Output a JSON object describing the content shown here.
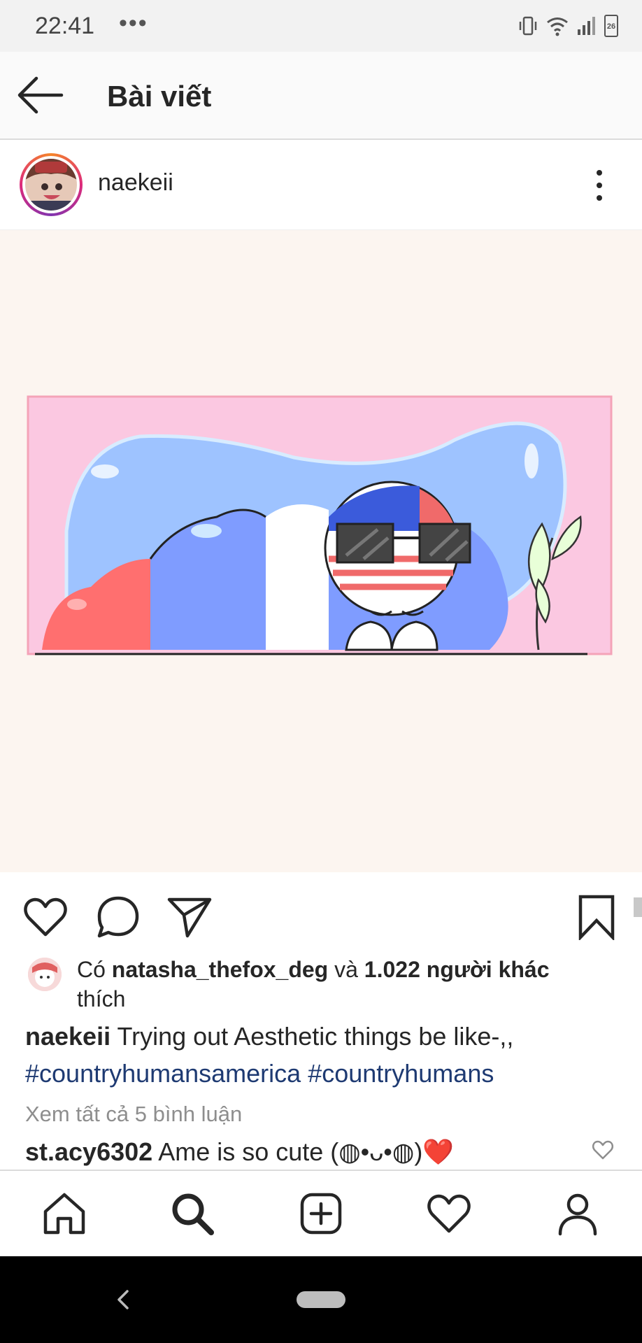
{
  "status_bar": {
    "time": "22:41",
    "more": "•••",
    "battery": "26"
  },
  "header": {
    "title": "Bài viết"
  },
  "post": {
    "username": "naekeii",
    "likes": {
      "prefix": "Có ",
      "liker": "natasha_thefox_deg",
      "middle": " và ",
      "others": "1.022 người khác",
      "suffix": " thích"
    },
    "caption": {
      "username": "naekeii",
      "text": " Trying out Aesthetic things be like-,,",
      "hashtags": "#countryhumansamerica #countryhumans"
    },
    "view_comments": "Xem tất cả 5 bình luận",
    "comment": {
      "username": "st.acy6302",
      "text": " Ame is so cute (◍•ᴗ•◍)❤️"
    }
  },
  "icons": {
    "back": "arrow-left-icon",
    "more": "more-vertical-icon",
    "like": "heart-icon",
    "comment": "comment-icon",
    "share": "send-icon",
    "save": "bookmark-icon",
    "nav": [
      "home-icon",
      "search-icon",
      "add-post-icon",
      "activity-icon",
      "profile-icon"
    ]
  },
  "colors": {
    "hashtag": "#1e3a72",
    "muted": "#8e8e8e",
    "image_bg": "#fcf5f0",
    "frame_pink": "#fbc8e1"
  }
}
